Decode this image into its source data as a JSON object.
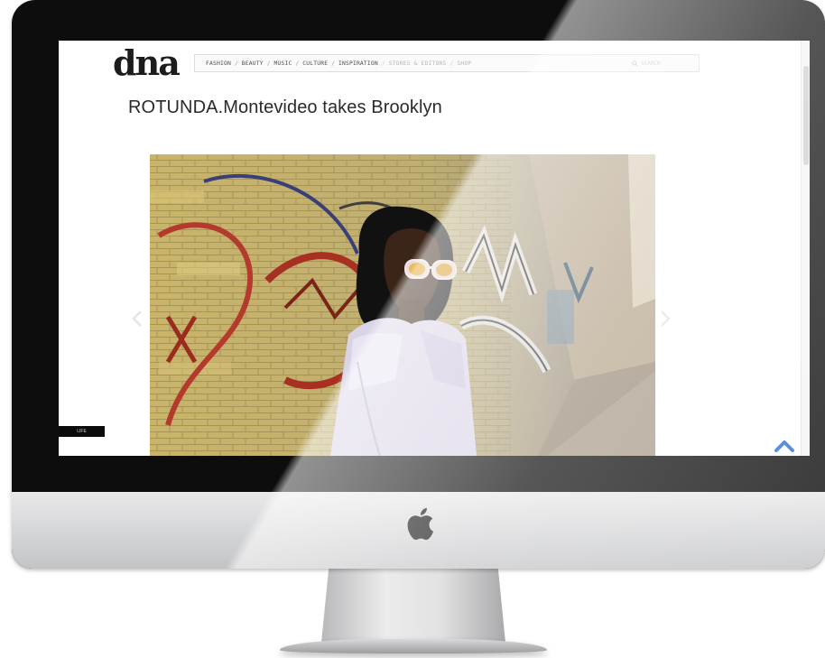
{
  "site": {
    "logo_text": "dna"
  },
  "nav": {
    "items": [
      {
        "label": "FASHION",
        "faded": false
      },
      {
        "label": "BEAUTY",
        "faded": false
      },
      {
        "label": "MUSIC",
        "faded": false
      },
      {
        "label": "CULTURE",
        "faded": false
      },
      {
        "label": "INSPIRATION",
        "faded": false
      },
      {
        "label": "STORES & EDITORS",
        "faded": true
      },
      {
        "label": "SHOP",
        "faded": true
      }
    ],
    "separator": "/",
    "search_placeholder": "SEARCH",
    "search_icon": "search-icon"
  },
  "article": {
    "title": "ROTUNDA.Montevideo takes Brooklyn"
  },
  "gallery": {
    "prev_icon": "chevron-left-icon",
    "next_icon": "chevron-right-icon"
  },
  "side_tab": {
    "label": "LIFE"
  },
  "back_to_top": {
    "icon": "chevron-up-icon",
    "color": "#2a6fd6"
  },
  "device": {
    "brand_icon": "apple-logo-icon"
  }
}
